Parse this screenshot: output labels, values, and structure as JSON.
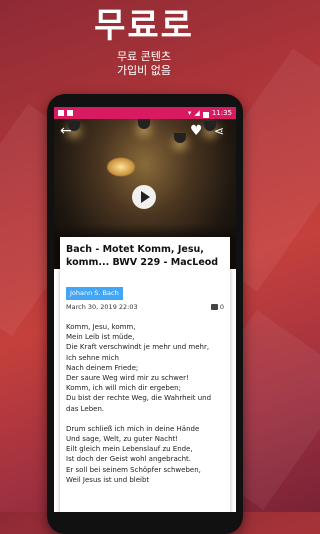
{
  "promo": {
    "title": "무료로",
    "line1": "무료 콘텐츠",
    "line2": "가입비 없음"
  },
  "statusbar": {
    "time": "11:35"
  },
  "post": {
    "title": "Bach - Motet Komm, Jesu, komm... BWV 229 - MacLeod",
    "tag": "Johann S. Bach",
    "date": "March 30, 2019 22:03",
    "comment_count": "0",
    "lyrics": [
      "Komm, Jesu, komm,",
      "Mein Leib ist müde,",
      "Die Kraft verschwindt je mehr und mehr,",
      "Ich sehne mich",
      "Nach deinem Friede;",
      "Der saure Weg wird mir zu schwer!",
      "Komm, ich will mich dir ergeben;",
      "Du bist der rechte Weg, die Wahrheit und",
      "das Leben.",
      "",
      "Drum schließ ich mich in deine Hände",
      "Und sage, Welt, zu guter Nacht!",
      "Eilt gleich mein Lebenslauf zu Ende,",
      "Ist doch der Geist wohl angebracht.",
      "Er soll bei seinem Schöpfer schweben,",
      "Weil Jesus ist und bleibt"
    ]
  },
  "icons": [
    "back-arrow-icon",
    "heart-icon",
    "share-icon",
    "play-icon",
    "comment-icon"
  ]
}
